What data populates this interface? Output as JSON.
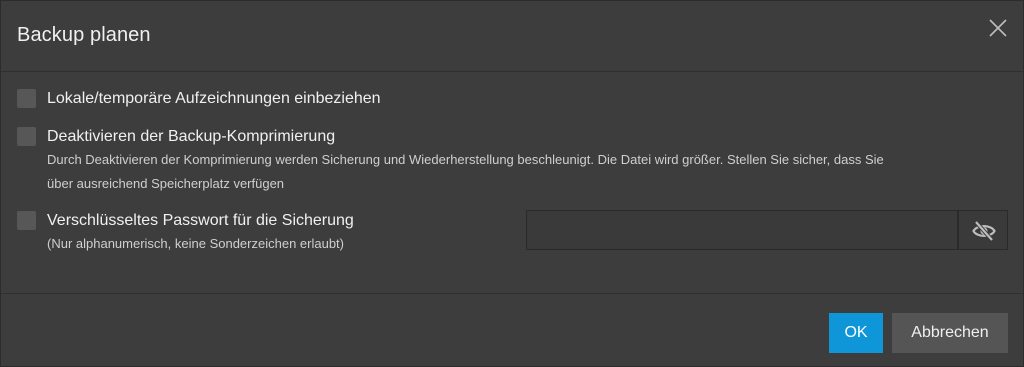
{
  "dialog": {
    "title": "Backup planen",
    "close_icon": "close-icon"
  },
  "options": [
    {
      "label": "Lokale/temporäre Aufzeichnungen einbeziehen",
      "checked": false
    },
    {
      "label": "Deaktivieren der Backup-Komprimierung",
      "description_line1": "Durch Deaktivieren der Komprimierung werden Sicherung und Wiederherstellung beschleunigt. Die Datei wird größer. Stellen Sie sicher, dass Sie",
      "description_line2": "über ausreichend Speicherplatz verfügen",
      "checked": false
    },
    {
      "label": "Verschlüsseltes Passwort für die Sicherung",
      "description": "(Nur alphanumerisch, keine Sonderzeichen erlaubt)",
      "checked": false
    }
  ],
  "password": {
    "value": "",
    "placeholder": "",
    "toggle_icon": "eye-slash-icon"
  },
  "buttons": {
    "ok": "OK",
    "cancel": "Abbrechen"
  },
  "colors": {
    "background": "#3d3d3d",
    "accent": "#0f96d8",
    "checkbox": "#575757",
    "secondary_button": "#555555"
  }
}
